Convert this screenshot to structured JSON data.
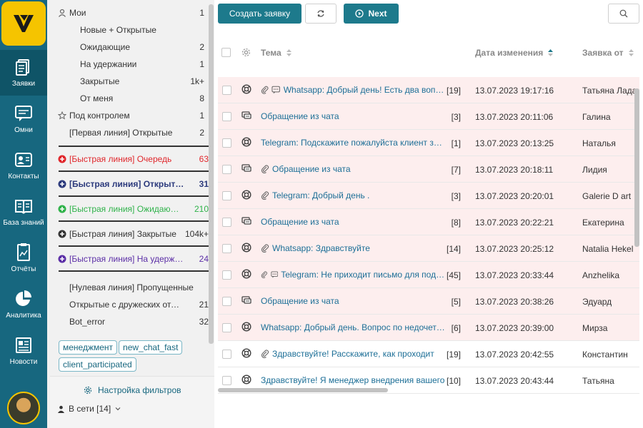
{
  "rail": {
    "items": [
      {
        "label": "Заявки",
        "icon": "tickets-icon"
      },
      {
        "label": "Омни",
        "icon": "chat-icon"
      },
      {
        "label": "Контакты",
        "icon": "contacts-icon"
      },
      {
        "label": "База знаний",
        "icon": "book-icon"
      },
      {
        "label": "Отчёты",
        "icon": "report-icon"
      },
      {
        "label": "Аналитика",
        "icon": "pie-chart-icon"
      },
      {
        "label": "Новости",
        "icon": "news-icon"
      }
    ]
  },
  "filters": {
    "my": {
      "label": "Мои",
      "count": "1"
    },
    "my_sub": [
      {
        "label": "Новые + Открытые",
        "count": ""
      },
      {
        "label": "Ожидающие",
        "count": "2"
      },
      {
        "label": "На удержании",
        "count": "1"
      },
      {
        "label": "Закрытые",
        "count": "1k+"
      },
      {
        "label": "От меня",
        "count": "8"
      }
    ],
    "watch": {
      "label": "Под контролем",
      "count": "1"
    },
    "first_line": {
      "label": "[Первая линия] Открытые",
      "count": "2"
    },
    "quick": [
      {
        "label": "[Быстрая линия] Очередь",
        "count": "63",
        "color": "#e0262b",
        "weight": "normal"
      },
      {
        "label": "[Быстрая линия] Открытые",
        "count": "31",
        "color": "#2c3a7c",
        "weight": "bold"
      },
      {
        "label": "[Быстрая линия] Ожидающие",
        "count": "210",
        "color": "#2fb24a",
        "weight": "normal"
      },
      {
        "label": "[Быстрая линия] Закрытые",
        "count": "104k+",
        "color": "#333333",
        "weight": "normal"
      },
      {
        "label": "[Быстрая линия] На удержании",
        "count": "24",
        "color": "#5b2ea6",
        "weight": "normal"
      }
    ],
    "other": [
      {
        "label": "[Нулевая линия] Пропущенные",
        "count": ""
      },
      {
        "label": "Открытые с дружеских отделов",
        "count": "21"
      },
      {
        "label": "Bot_error",
        "count": "32"
      }
    ],
    "tags": [
      "менеджмент",
      "new_chat_fast",
      "client_participated"
    ],
    "settings_label": "Настройка фильтров",
    "online_label": "В сети [14]"
  },
  "toolbar": {
    "create_label": "Создать заявку",
    "next_label": "Next"
  },
  "table": {
    "headers": {
      "topic": "Тема",
      "date": "Дата изменения",
      "from": "Заявка от"
    },
    "rows": [
      {
        "type": "support",
        "attach": true,
        "note": true,
        "topic": "Whatsapp: Добрый день! Есть два вопроса",
        "count": "[19]",
        "date": "13.07.2023 19:17:16",
        "from": "Татьяна Ладан",
        "pink": true
      },
      {
        "type": "chat",
        "attach": false,
        "note": false,
        "topic": "Обращение из чата",
        "count": "[3]",
        "date": "13.07.2023 20:11:06",
        "from": "Галина",
        "pink": true
      },
      {
        "type": "support",
        "attach": false,
        "note": false,
        "topic": "Telegram: Подскажите пожалуйста клиент зашел",
        "count": "[1]",
        "date": "13.07.2023 20:13:25",
        "from": "Наталья",
        "pink": true
      },
      {
        "type": "chat",
        "attach": true,
        "note": false,
        "topic": "Обращение из чата",
        "count": "[7]",
        "date": "13.07.2023 20:18:11",
        "from": "Лидия",
        "pink": true
      },
      {
        "type": "support",
        "attach": true,
        "note": false,
        "topic": "Telegram: Добрый день .",
        "count": "[3]",
        "date": "13.07.2023 20:20:01",
        "from": "Galerie D art",
        "pink": true
      },
      {
        "type": "chat",
        "attach": false,
        "note": false,
        "topic": "Обращение из чата",
        "count": "[8]",
        "date": "13.07.2023 20:22:21",
        "from": "Екатерина",
        "pink": true
      },
      {
        "type": "support",
        "attach": true,
        "note": false,
        "topic": "Whatsapp: Здравствуйте",
        "count": "[14]",
        "date": "13.07.2023 20:25:12",
        "from": "Natalia Hekel",
        "pink": true
      },
      {
        "type": "support",
        "attach": true,
        "note": true,
        "topic": "Telegram: Не приходит письмо для подтверждения",
        "count": "[45]",
        "date": "13.07.2023 20:33:44",
        "from": "Anzhelika",
        "pink": true
      },
      {
        "type": "chat",
        "attach": false,
        "note": false,
        "topic": "Обращение из чата",
        "count": "[5]",
        "date": "13.07.2023 20:38:26",
        "from": "Эдуард",
        "pink": true
      },
      {
        "type": "support",
        "attach": false,
        "note": false,
        "topic": "Whatsapp: Добрый день. Вопрос по недочетам",
        "count": "[6]",
        "date": "13.07.2023 20:39:00",
        "from": "Мирза",
        "pink": true
      },
      {
        "type": "support",
        "attach": true,
        "note": false,
        "topic": "Здравствуйте! Расскажите, как проходит",
        "count": "[19]",
        "date": "13.07.2023 20:42:55",
        "from": "Константин",
        "pink": false
      },
      {
        "type": "support",
        "attach": false,
        "note": false,
        "topic": "Здравствуйте! Я менеджер внедрения вашего",
        "count": "[10]",
        "date": "13.07.2023 20:43:44",
        "from": "Татьяна",
        "pink": false
      }
    ]
  },
  "colors": {
    "rail": "#17677f",
    "accent": "#1d7a8c",
    "logo": "#f5c400",
    "pink_row": "#fdeeee"
  }
}
